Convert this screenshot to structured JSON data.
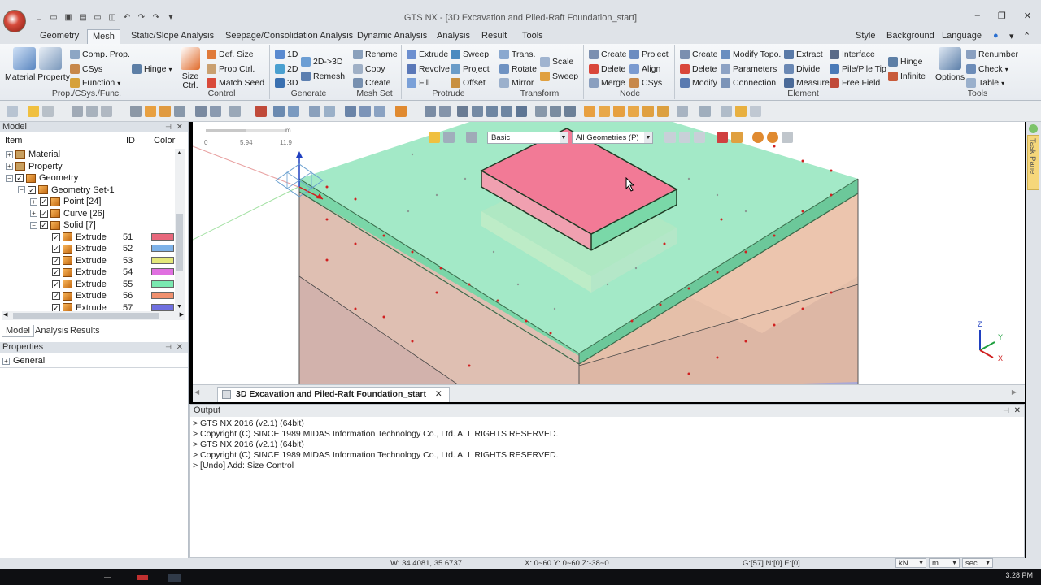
{
  "window": {
    "title": "GTS NX - [3D Excavation and Piled-Raft Foundation_start]",
    "controls": [
      "–",
      "❐",
      "✕"
    ]
  },
  "ribbon_tabs": [
    "Geometry",
    "Mesh",
    "Static/Slope Analysis",
    "Seepage/Consolidation Analysis",
    "Dynamic Analysis",
    "Analysis",
    "Result",
    "Tools"
  ],
  "active_tab": "Mesh",
  "ribbon_right": {
    "style": "Style",
    "background": "Background",
    "language": "Language"
  },
  "groups": {
    "prop": {
      "label": "Prop./CSys./Func.",
      "material_property": "Material Property",
      "comp_prop": "Comp. Prop.",
      "csys": "CSys",
      "function": "Function",
      "hinge": "Hinge"
    },
    "control": {
      "label": "Control",
      "size_ctrl": "Size Ctrl.",
      "def_size": "Def. Size",
      "prop_ctrl": "Prop Ctrl.",
      "match_seed": "Match Seed"
    },
    "generate": {
      "label": "Generate",
      "d1": "1D",
      "d2": "2D",
      "d3": "3D",
      "d2to3": "2D->3D",
      "remesh": "Remesh"
    },
    "meshset": {
      "label": "Mesh Set",
      "rename": "Rename",
      "copy": "Copy",
      "create": "Create"
    },
    "protrude": {
      "label": "Protrude",
      "extrude": "Extrude",
      "revolve": "Revolve",
      "fill": "Fill",
      "sweep": "Sweep",
      "project": "Project",
      "offset": "Offset"
    },
    "transform": {
      "label": "Transform",
      "trans": "Trans.",
      "rotate": "Rotate",
      "mirror": "Mirror",
      "scale": "Scale",
      "sweep": "Sweep"
    },
    "node": {
      "label": "Node",
      "create": "Create",
      "delete": "Delete",
      "merge": "Merge",
      "project": "Project",
      "align": "Align",
      "csys": "CSys"
    },
    "element": {
      "label": "Element",
      "create": "Create",
      "delete": "Delete",
      "modify": "Modify",
      "modify_topo": "Modify Topo.",
      "parameters": "Parameters",
      "connection": "Connection",
      "extract": "Extract",
      "divide": "Divide",
      "measure": "Measure",
      "interface": "Interface",
      "pile_tip": "Pile/Pile Tip",
      "free_field": "Free Field",
      "hinge": "Hinge",
      "infinite": "Infinite"
    },
    "tools": {
      "label": "Tools",
      "options": "Options",
      "renumber": "Renumber",
      "check": "Check",
      "table": "Table"
    }
  },
  "model_panel": {
    "title": "Model",
    "columns": {
      "item": "Item",
      "id": "ID",
      "color": "Color"
    },
    "tree": [
      {
        "label": "Material",
        "level": 0,
        "exp": "+",
        "check": false,
        "id": "",
        "color": ""
      },
      {
        "label": "Property",
        "level": 0,
        "exp": "+",
        "check": false,
        "id": "",
        "color": ""
      },
      {
        "label": "Geometry",
        "level": 0,
        "exp": "−",
        "check": true,
        "id": "",
        "color": ""
      },
      {
        "label": "Geometry Set-1",
        "level": 1,
        "exp": "−",
        "check": true,
        "id": "",
        "color": ""
      },
      {
        "label": "Point [24]",
        "level": 2,
        "exp": "+",
        "check": true,
        "id": "",
        "color": ""
      },
      {
        "label": "Curve [26]",
        "level": 2,
        "exp": "+",
        "check": true,
        "id": "",
        "color": ""
      },
      {
        "label": "Solid [7]",
        "level": 2,
        "exp": "−",
        "check": true,
        "id": "",
        "color": ""
      },
      {
        "label": "Extrude",
        "level": 3,
        "exp": "",
        "check": true,
        "id": "51",
        "color": "#e8687c"
      },
      {
        "label": "Extrude",
        "level": 3,
        "exp": "",
        "check": true,
        "id": "52",
        "color": "#7eb2e8"
      },
      {
        "label": "Extrude",
        "level": 3,
        "exp": "",
        "check": true,
        "id": "53",
        "color": "#e4e87a"
      },
      {
        "label": "Extrude",
        "level": 3,
        "exp": "",
        "check": true,
        "id": "54",
        "color": "#e070e0"
      },
      {
        "label": "Extrude",
        "level": 3,
        "exp": "",
        "check": true,
        "id": "55",
        "color": "#7ae8b0"
      },
      {
        "label": "Extrude",
        "level": 3,
        "exp": "",
        "check": true,
        "id": "56",
        "color": "#f0906e"
      },
      {
        "label": "Extrude",
        "level": 3,
        "exp": "",
        "check": true,
        "id": "57",
        "color": "#7070e0"
      }
    ],
    "tabs": [
      "Model",
      "Analysis",
      "Results"
    ]
  },
  "properties_panel": {
    "title": "Properties",
    "general": "General"
  },
  "viewport": {
    "ruler": {
      "labels": [
        "0",
        "5.94",
        "11.9"
      ],
      "unit": "m"
    },
    "display_mode": "Basic",
    "filter": "All Geometries (P)",
    "triad": {
      "z": "Z",
      "y": "Y",
      "x": "X"
    }
  },
  "task_pane": {
    "label": "Task Pane"
  },
  "document_tab": {
    "label": "3D Excavation and Piled-Raft Foundation_start"
  },
  "output": {
    "title": "Output",
    "lines": [
      "> GTS NX 2016 (v2.1) (64bit)",
      "> Copyright (C) SINCE 1989 MIDAS Information Technology Co., Ltd. ALL RIGHTS RESERVED.",
      "> GTS NX 2016 (v2.1) (64bit)",
      "> Copyright (C) SINCE 1989 MIDAS Information Technology Co., Ltd. ALL RIGHTS RESERVED.",
      "> [Undo] Add: Size Control"
    ]
  },
  "status": {
    "w": "W: 34.4081, 35.6737",
    "angles": "X: 0~60 Y: 0~60 Z:-38~0",
    "selection": "G:[57] N:[0] E:[0]",
    "force_unit": "kN",
    "length_unit": "m",
    "time_unit": "sec"
  },
  "taskbar": {
    "clock": "3:28 PM"
  }
}
